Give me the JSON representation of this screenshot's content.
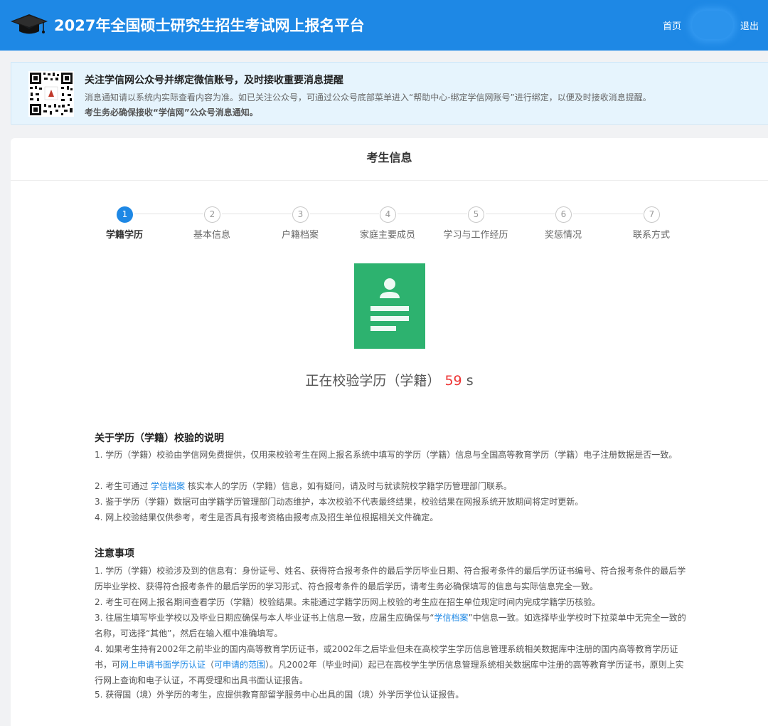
{
  "header": {
    "title": "2027年全国硕士研究生招生考试网上报名平台",
    "nav_home": "首页",
    "nav_logout": "退出",
    "bg_color": "#1e88e5"
  },
  "notice": {
    "title": "关注学信网公众号并绑定微信账号，及时接收重要消息提醒",
    "line1": "消息通知请以系统内实际查看内容为准。如已关注公众号，可通过公众号底部菜单进入“帮助中心-绑定学信网账号”进行绑定，以便及时接收消息提醒。",
    "line2": "考生务必确保接收“学信网”公众号消息通知。"
  },
  "card": {
    "title": "考生信息"
  },
  "steps": [
    {
      "num": "1",
      "label": "学籍学历",
      "active": true
    },
    {
      "num": "2",
      "label": "基本信息",
      "active": false
    },
    {
      "num": "3",
      "label": "户籍档案",
      "active": false
    },
    {
      "num": "4",
      "label": "家庭主要成员",
      "active": false
    },
    {
      "num": "5",
      "label": "学习与工作经历",
      "active": false
    },
    {
      "num": "6",
      "label": "奖惩情况",
      "active": false
    },
    {
      "num": "7",
      "label": "联系方式",
      "active": false
    }
  ],
  "verify": {
    "text": "正在校验学历（学籍）",
    "countdown": "59",
    "unit": "s",
    "icon_color": "#2db26f"
  },
  "about": {
    "title": "关于学历（学籍）校验的说明",
    "p1": "1. 学历（学籍）校验由学信网免费提供，仅用来校验考生在网上报名系统中填写的学历（学籍）信息与全国高等教育学历（学籍）电子注册数据是否一致。",
    "p2_pre": "2. 考生可通过 ",
    "p2_link": "学信档案",
    "p2_post": " 核实本人的学历（学籍）信息，如有疑问，请及时与就读院校学籍学历管理部门联系。",
    "p3": "3. 鉴于学历（学籍）数据可由学籍学历管理部门动态维护，本次校验不代表最终结果，校验结果在网报系统开放期间将定时更新。",
    "p4": "4. 网上校验结果仅供参考，考生是否具有报考资格由报考点及招生单位根据相关文件确定。"
  },
  "notes": {
    "title": "注意事项",
    "p1": "1. 学历（学籍）校验涉及到的信息有：身份证号、姓名、获得符合报考条件的最后学历毕业日期、符合报考条件的最后学历证书编号、符合报考条件的最后学历毕业学校、获得符合报考条件的最后学历的学习形式、符合报考条件的最后学历，请考生务必确保填写的信息与实际信息完全一致。",
    "p2": "2. 考生可在网上报名期间查看学历（学籍）校验结果。未能通过学籍学历网上校验的考生应在招生单位规定时间内完成学籍学历核验。",
    "p3_pre": "3. 往届生填写毕业学校以及毕业日期应确保与本人毕业证书上信息一致，应届生应确保与“",
    "p3_link": "学信档案",
    "p3_post": "”中信息一致。如选择毕业学校时下拉菜单中无完全一致的名称，可选择“其他”，然后在输入框中准确填写。",
    "p4_pre": "4. 如果考生持有2002年之前毕业的国内高等教育学历证书，或2002年之后毕业但未在高校学生学历信息管理系统相关数据库中注册的国内高等教育学历证书，可",
    "p4_link1": "网上申请书面学历认证",
    "p4_mid": "（",
    "p4_link2": "可申请的范围",
    "p4_post": "）。凡2002年（毕业时间）起已在高校学生学历信息管理系统相关数据库中注册的高等教育学历证书，原则上实行网上查询和电子认证，不再受理和出具书面认证报告。",
    "p5": "5. 获得国（境）外学历的考生，应提供教育部留学服务中心出具的国（境）外学历学位认证报告。"
  }
}
